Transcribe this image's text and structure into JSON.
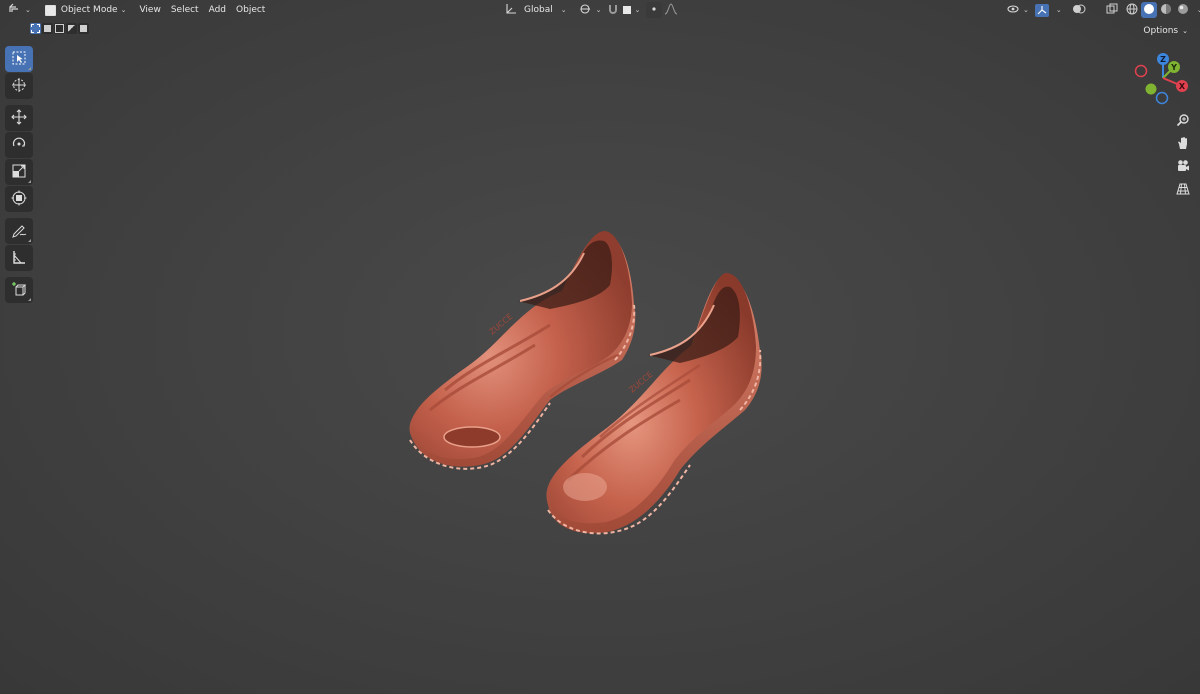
{
  "header": {
    "editor_type_icon": "viewport-icon",
    "mode_label": "Object Mode",
    "menus": [
      "View",
      "Select",
      "Add",
      "Object"
    ],
    "orientation_label": "Global"
  },
  "options_label": "Options",
  "toolbar_tools": [
    {
      "name": "select-box-tool",
      "icon": "cursor-box-icon",
      "active": true
    },
    {
      "name": "cursor-tool",
      "icon": "3d-cursor-icon"
    },
    {
      "name": "move-tool",
      "icon": "move-arrows-icon"
    },
    {
      "name": "rotate-tool",
      "icon": "rotate-icon"
    },
    {
      "name": "scale-tool",
      "icon": "scale-icon"
    },
    {
      "name": "transform-tool",
      "icon": "transform-icon"
    },
    {
      "name": "annotate-tool",
      "icon": "pencil-icon"
    },
    {
      "name": "measure-tool",
      "icon": "ruler-icon"
    },
    {
      "name": "add-cube-tool",
      "icon": "add-cube-icon"
    }
  ],
  "gizmo": {
    "z_label": "Z",
    "y_label": "Y",
    "x_label": "X"
  },
  "colors": {
    "accent": "#4772b3",
    "axis_x": "#e0414f",
    "axis_y": "#7fb331",
    "axis_z": "#3d86de",
    "shoe": "#c4614c"
  }
}
